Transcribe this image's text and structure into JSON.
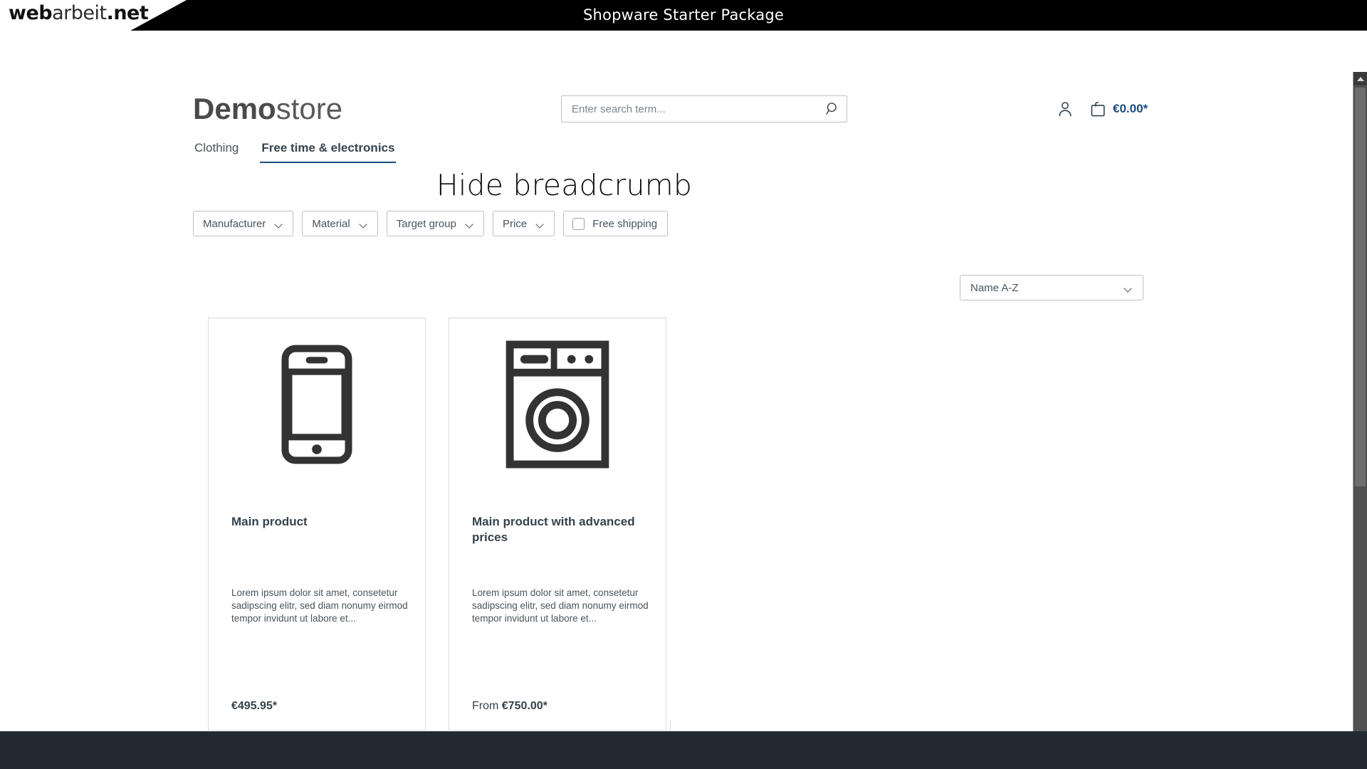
{
  "topbar": {
    "logo_part1": "web",
    "logo_part2": "arbeit",
    "logo_part3": ".net",
    "title": "Shopware Starter Package"
  },
  "header": {
    "shop_name_bold": "Demo",
    "shop_name_light": "store",
    "search": {
      "placeholder": "Enter search term...",
      "value": "",
      "icon": "search-icon"
    },
    "account_icon": "person-icon",
    "cart": {
      "icon": "shopping-bag-icon",
      "total": "€0.00*",
      "accent_color": "#1b4b7e"
    }
  },
  "nav": {
    "items": [
      {
        "label": "Clothing",
        "active": false
      },
      {
        "label": "Free time & electronics",
        "active": true
      }
    ]
  },
  "page": {
    "heading": "Hide breadcrumb"
  },
  "filters": {
    "dropdowns": [
      {
        "label": "Manufacturer",
        "icon": "chevron-down-icon"
      },
      {
        "label": "Material",
        "icon": "chevron-down-icon"
      },
      {
        "label": "Target group",
        "icon": "chevron-down-icon"
      },
      {
        "label": "Price",
        "icon": "chevron-down-icon"
      }
    ],
    "checkbox": {
      "label": "Free shipping",
      "checked": false
    }
  },
  "sorting": {
    "selected": "Name A-Z",
    "icon": "chevron-down-icon"
  },
  "products": [
    {
      "image_icon": "smartphone-icon",
      "title": "Main product",
      "description": "Lorem ipsum dolor sit amet, consetetur sadipscing elitr, sed diam nonumy eirmod tempor invidunt ut labore et...",
      "price_prefix": "",
      "price": "€495.95*"
    },
    {
      "image_icon": "washing-machine-icon",
      "title": "Main product with advanced prices",
      "description": "Lorem ipsum dolor sit amet, consetetur sadipscing elitr, sed diam nonumy eirmod tempor invidunt ut labore et...",
      "price_prefix": "From ",
      "price": "€750.00*"
    }
  ],
  "scrollbar": {
    "up_arrow_icon": "scroll-up-arrow-icon"
  }
}
